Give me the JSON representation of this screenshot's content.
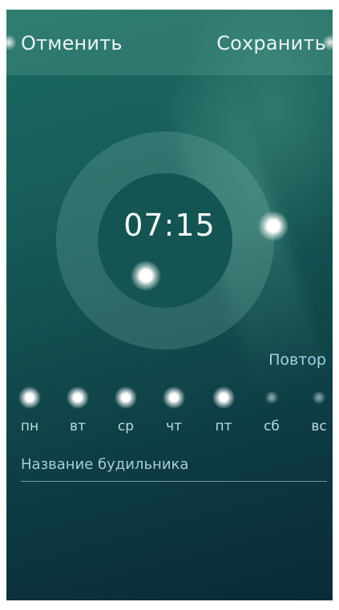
{
  "header": {
    "cancel_label": "Отменить",
    "save_label": "Сохранить"
  },
  "alarm": {
    "time": "07:15"
  },
  "repeat": {
    "label": "Повтор",
    "days": [
      {
        "label": "пн",
        "selected": true
      },
      {
        "label": "вт",
        "selected": true
      },
      {
        "label": "ср",
        "selected": true
      },
      {
        "label": "чт",
        "selected": true
      },
      {
        "label": "пт",
        "selected": true
      },
      {
        "label": "сб",
        "selected": false
      },
      {
        "label": "вс",
        "selected": false
      }
    ]
  },
  "name_field": {
    "placeholder": "Название будильника",
    "value": ""
  },
  "colors": {
    "accent": "#9fd3e6",
    "background_top": "#1d6a63",
    "background_bottom": "#0a2c37"
  }
}
